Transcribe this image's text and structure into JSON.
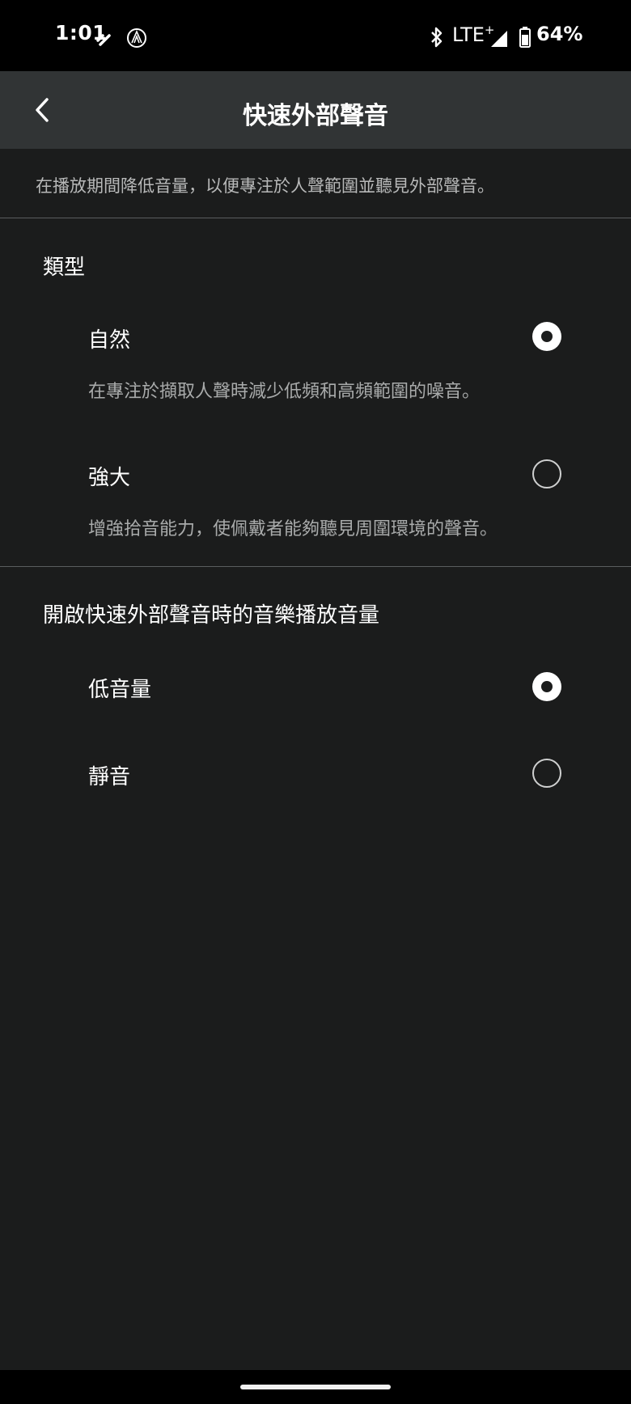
{
  "status_bar": {
    "time": "1:01",
    "network": "LTE",
    "network_suffix": "+",
    "battery": "64%",
    "icons": [
      "link-icon",
      "audio-technica-logo-icon",
      "bluetooth-icon",
      "signal-icon",
      "battery-icon"
    ]
  },
  "header": {
    "title": "快速外部聲音",
    "back_icon": "back-arrow-icon"
  },
  "description": "在播放期間降低音量，以便專注於人聲範圍並聽見外部聲音。",
  "type_section": {
    "title": "類型",
    "options": [
      {
        "label": "自然",
        "description": "在專注於擷取人聲時減少低頻和高頻範圍的噪音。",
        "selected": true
      },
      {
        "label": "強大",
        "description": "增強拾音能力，使佩戴者能夠聽見周圍環境的聲音。",
        "selected": false
      }
    ]
  },
  "volume_section": {
    "title": "開啟快速外部聲音時的音樂播放音量",
    "options": [
      {
        "label": "低音量",
        "selected": true
      },
      {
        "label": "靜音",
        "selected": false
      }
    ]
  },
  "colors": {
    "background": "#1b1c1c",
    "app_bar": "#313435",
    "status_bar": "#000000",
    "primary_text": "#ffffff",
    "secondary_text": "#a9abab"
  }
}
